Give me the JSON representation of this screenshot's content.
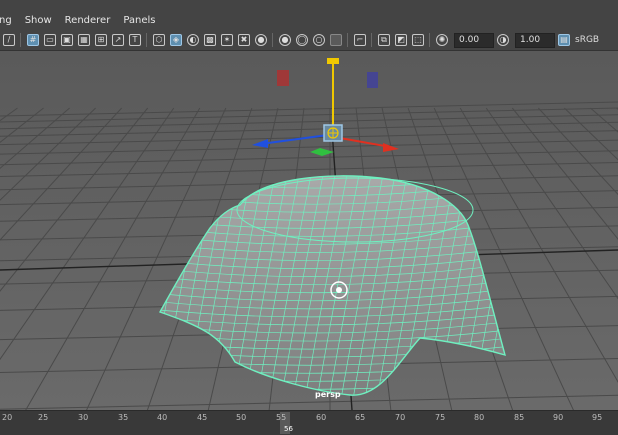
{
  "menu": {
    "items": [
      "ng",
      "Show",
      "Renderer",
      "Panels"
    ]
  },
  "toolbar": {
    "value_a": "0.00",
    "value_b": "1.00",
    "color_space": "sRGB"
  },
  "viewport": {
    "camera_label": "persp"
  },
  "timeline": {
    "ticks": [
      "20",
      "25",
      "30",
      "35",
      "40",
      "45",
      "50",
      "55",
      "60",
      "65",
      "70",
      "75",
      "80",
      "85",
      "90",
      "95"
    ],
    "current_frame": "56"
  },
  "colors": {
    "wireframe": "#6ff0c0",
    "selection_blue": "#9ec7e6",
    "pivot_yellow": "#f0c800",
    "axis_x": "#e03020",
    "axis_z": "#2050e0",
    "axis_y_plane": "#30c040"
  }
}
